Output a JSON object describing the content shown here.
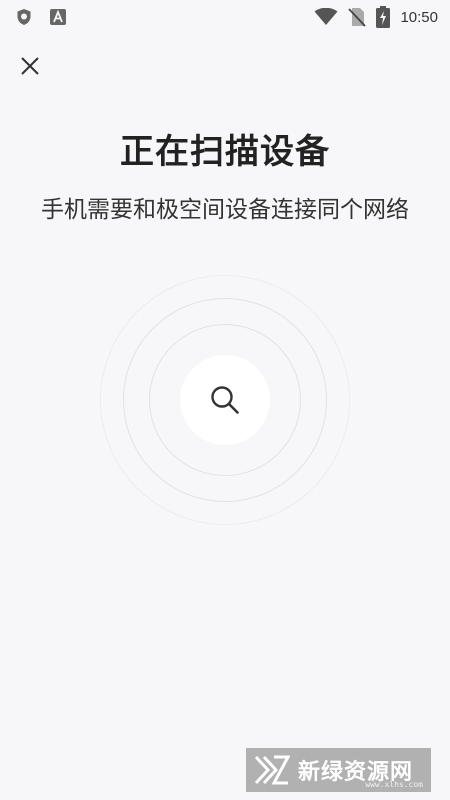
{
  "status_bar": {
    "time": "10:50",
    "icons": [
      "shield-icon",
      "a-badge-icon",
      "wifi-icon",
      "no-sim-icon",
      "battery-charging-icon"
    ]
  },
  "header": {
    "close_icon": "close-icon"
  },
  "main": {
    "title": "正在扫描设备",
    "subtitle": "手机需要和极空间设备连接同个网络",
    "scan_icon": "search-icon"
  },
  "watermark": {
    "text": "新绿资源网",
    "url": "www.xlhs.com"
  },
  "colors": {
    "background": "#f7f7f9",
    "text": "#222222",
    "ring": "#e2e2e6"
  }
}
